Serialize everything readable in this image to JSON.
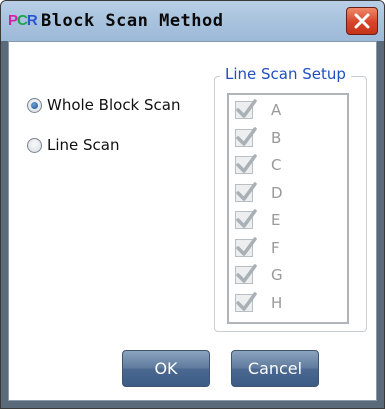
{
  "window": {
    "title": "Block Scan Method",
    "icon_text": {
      "p": "P",
      "c": "C",
      "r": "R"
    }
  },
  "options": {
    "whole_block": {
      "label": "Whole Block Scan",
      "selected": true
    },
    "line_scan": {
      "label": "Line Scan",
      "selected": false
    }
  },
  "line_scan_setup": {
    "title": "Line Scan Setup",
    "rows": [
      {
        "label": "A",
        "checked": true
      },
      {
        "label": "B",
        "checked": true
      },
      {
        "label": "C",
        "checked": true
      },
      {
        "label": "D",
        "checked": true
      },
      {
        "label": "E",
        "checked": true
      },
      {
        "label": "F",
        "checked": true
      },
      {
        "label": "G",
        "checked": true
      },
      {
        "label": "H",
        "checked": true
      }
    ]
  },
  "buttons": {
    "ok": "OK",
    "cancel": "Cancel"
  },
  "colors": {
    "group_title": "#1f4fc0",
    "button": "#4a6890",
    "close": "#d8442a"
  }
}
